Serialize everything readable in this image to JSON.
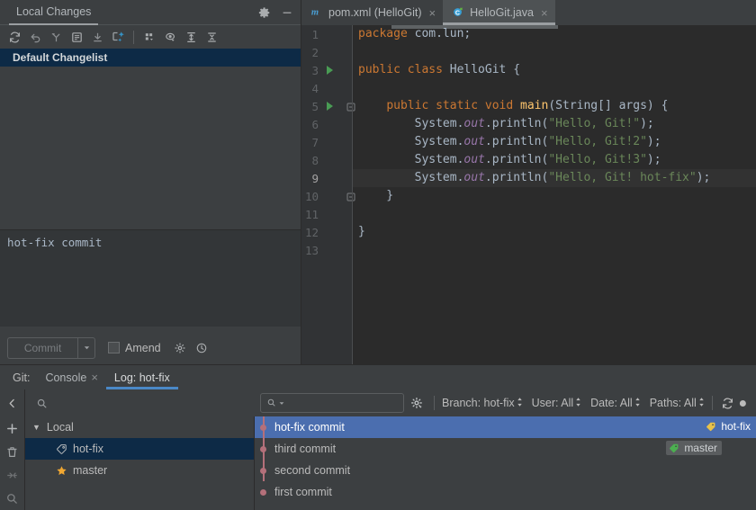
{
  "local_changes": {
    "tab_title": "Local Changes",
    "settings_icon": "gear-icon",
    "minimize_icon": "minimize-icon",
    "toolbar": [
      {
        "name": "refresh-icon",
        "label": "Refresh"
      },
      {
        "name": "rollback-icon",
        "label": "Rollback"
      },
      {
        "name": "shelve-icon",
        "label": "Shelve Silently"
      },
      {
        "name": "show-diff-icon",
        "label": "Show Diff"
      },
      {
        "name": "get-from-vcs-icon",
        "label": "Get from VCS"
      },
      {
        "name": "compare-with-branch-icon",
        "label": "Compare with Branch"
      },
      {
        "name": "group-by-icon",
        "label": "Group By"
      },
      {
        "name": "preview-diff-icon",
        "label": "Preview Diff"
      },
      {
        "name": "expand-all-icon",
        "label": "Expand All"
      },
      {
        "name": "collapse-all-icon",
        "label": "Collapse All"
      }
    ],
    "changelist_name": "Default Changelist",
    "commit_message": "hot-fix commit",
    "commit_button_label": "Commit",
    "commit_dropdown_icon": "chevron-down-icon",
    "amend_label": "Amend",
    "amend_checked": false,
    "commit_options_icon": "gear-icon",
    "commit_history_icon": "clock-icon"
  },
  "editor": {
    "tabs": [
      {
        "label": "pom.xml (HelloGit)",
        "icon": "maven-icon",
        "active": false,
        "closable": true
      },
      {
        "label": "HelloGit.java",
        "icon": "java-class-icon",
        "active": true,
        "closable": true
      }
    ],
    "close_glyph": "×",
    "lines": [
      {
        "num": "1",
        "run": false,
        "fold": "",
        "current": false,
        "tokens": [
          {
            "t": "kw",
            "v": "package"
          },
          {
            "t": "plain",
            "v": " com.lun;"
          }
        ]
      },
      {
        "num": "2",
        "run": false,
        "fold": "",
        "current": false,
        "tokens": []
      },
      {
        "num": "3",
        "run": true,
        "fold": "",
        "current": false,
        "tokens": [
          {
            "t": "kw",
            "v": "public class"
          },
          {
            "t": "plain",
            "v": " HelloGit {"
          }
        ]
      },
      {
        "num": "4",
        "run": false,
        "fold": "",
        "current": false,
        "tokens": []
      },
      {
        "num": "5",
        "run": true,
        "fold": "minus",
        "current": false,
        "tokens": [
          {
            "t": "plain",
            "v": "    "
          },
          {
            "t": "kw",
            "v": "public static void"
          },
          {
            "t": "plain",
            "v": " "
          },
          {
            "t": "meth",
            "v": "main"
          },
          {
            "t": "plain",
            "v": "(String[] args) {"
          }
        ]
      },
      {
        "num": "6",
        "run": false,
        "fold": "",
        "current": false,
        "tokens": [
          {
            "t": "plain",
            "v": "        System."
          },
          {
            "t": "fld",
            "v": "out"
          },
          {
            "t": "plain",
            "v": ".println("
          },
          {
            "t": "str",
            "v": "\"Hello, Git!\""
          },
          {
            "t": "plain",
            "v": ");"
          }
        ]
      },
      {
        "num": "7",
        "run": false,
        "fold": "",
        "current": false,
        "tokens": [
          {
            "t": "plain",
            "v": "        System."
          },
          {
            "t": "fld",
            "v": "out"
          },
          {
            "t": "plain",
            "v": ".println("
          },
          {
            "t": "str",
            "v": "\"Hello, Git!2\""
          },
          {
            "t": "plain",
            "v": ");"
          }
        ]
      },
      {
        "num": "8",
        "run": false,
        "fold": "",
        "current": false,
        "tokens": [
          {
            "t": "plain",
            "v": "        System."
          },
          {
            "t": "fld",
            "v": "out"
          },
          {
            "t": "plain",
            "v": ".println("
          },
          {
            "t": "str",
            "v": "\"Hello, Git!3\""
          },
          {
            "t": "plain",
            "v": ");"
          }
        ]
      },
      {
        "num": "9",
        "run": false,
        "fold": "",
        "current": true,
        "tokens": [
          {
            "t": "plain",
            "v": "        System."
          },
          {
            "t": "fld",
            "v": "out"
          },
          {
            "t": "plain",
            "v": ".println("
          },
          {
            "t": "str",
            "v": "\"Hello, Git! hot-fix\""
          },
          {
            "t": "plain",
            "v": ");"
          }
        ]
      },
      {
        "num": "10",
        "run": false,
        "fold": "minus",
        "current": false,
        "tokens": [
          {
            "t": "plain",
            "v": "    }"
          }
        ]
      },
      {
        "num": "11",
        "run": false,
        "fold": "",
        "current": false,
        "tokens": []
      },
      {
        "num": "12",
        "run": false,
        "fold": "",
        "current": false,
        "tokens": [
          {
            "t": "plain",
            "v": "}"
          }
        ]
      },
      {
        "num": "13",
        "run": false,
        "fold": "",
        "current": false,
        "tokens": []
      }
    ]
  },
  "git_panel": {
    "title": "Git:",
    "tabs": [
      {
        "label": "Console",
        "active": false,
        "closable": true
      },
      {
        "label": "Log: hot-fix",
        "active": true,
        "closable": false
      }
    ],
    "close_glyph": "×",
    "collapse_icon": "chevron-left-icon",
    "search_placeholder": "",
    "search_icon": "search-icon",
    "filter_search_icon": "search-dropdown-icon",
    "filter_gear_icon": "gear-icon",
    "refresh_icon": "refresh-icon",
    "filters": [
      {
        "label": "Branch: hot-fix",
        "name": "branch-filter"
      },
      {
        "label": "User: All",
        "name": "user-filter"
      },
      {
        "label": "Date: All",
        "name": "date-filter"
      },
      {
        "label": "Paths: All",
        "name": "paths-filter"
      }
    ],
    "rail_icons": [
      {
        "name": "add-branch-icon"
      },
      {
        "name": "delete-branch-icon"
      },
      {
        "name": "merge-icon"
      },
      {
        "name": "search-icon"
      }
    ],
    "branch_tree": {
      "root_label": "Local",
      "expand_glyph": "▼",
      "items": [
        {
          "label": "hot-fix",
          "icon": "branch-tag-icon",
          "selected": true
        },
        {
          "label": "master",
          "icon": "favorite-star-icon",
          "selected": false
        }
      ]
    },
    "commits": [
      {
        "subject": "hot-fix commit",
        "selected": true,
        "ref": {
          "label": "hot-fix",
          "style": "current",
          "icon": "branch-tag-icon"
        }
      },
      {
        "subject": "third commit",
        "selected": false,
        "ref": {
          "label": "master",
          "style": "other",
          "icon": "branch-tag-icon"
        }
      },
      {
        "subject": "second commit",
        "selected": false,
        "ref": null
      },
      {
        "subject": "first commit",
        "selected": false,
        "ref": null
      }
    ]
  },
  "colors": {
    "accent_blue": "#4b6eaf",
    "tab_underline": "#4a88c7",
    "selection_navy": "#0d2a46",
    "graph_line": "#b4707a",
    "tag_yellow": "#e8c24a",
    "tag_green": "#4caf50",
    "run_green": "#499c54",
    "keyword_orange": "#cc7832",
    "string_green": "#6a8759",
    "field_purple": "#9876aa"
  }
}
